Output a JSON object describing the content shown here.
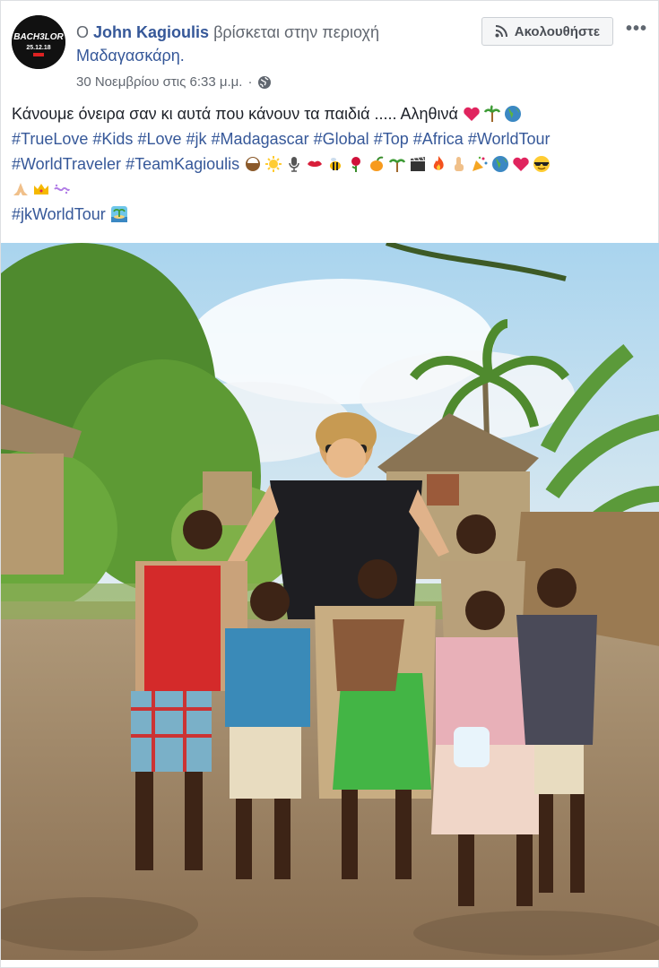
{
  "post": {
    "author_prefix": "Ο",
    "author_name": "John Kagioulis",
    "location_text": "βρίσκεται στην περιοχή",
    "location_name": "Μαδαγασκάρη.",
    "timestamp": "30 Νοεμβρίου στις 6:33 μ.μ.",
    "separator": "·",
    "privacy_icon": "globe-icon",
    "follow_label": "Ακολουθήστε",
    "more_label": "•••",
    "avatar_logo": {
      "line1": "BACH3LOR",
      "line2": "25.12.18"
    },
    "message": "Κάνουμε όνειρα σαν κι αυτά που κάνουν τα παιδιά ..... Αληθινά",
    "hashtags_line1": [
      "#TrueLove",
      "#Kids",
      "#Love",
      "#jk",
      "#Madagascar",
      "#Global",
      "#Top",
      "#Africa",
      "#WorldTour"
    ],
    "hashtags_line2": [
      "#WorldTraveler",
      "#TeamKagioulis"
    ],
    "hashtags_line4": [
      "#jkWorldTour"
    ],
    "photo_subject": "photo"
  },
  "colors": {
    "link": "#365899",
    "meta": "#616770",
    "text": "#1d2129"
  }
}
